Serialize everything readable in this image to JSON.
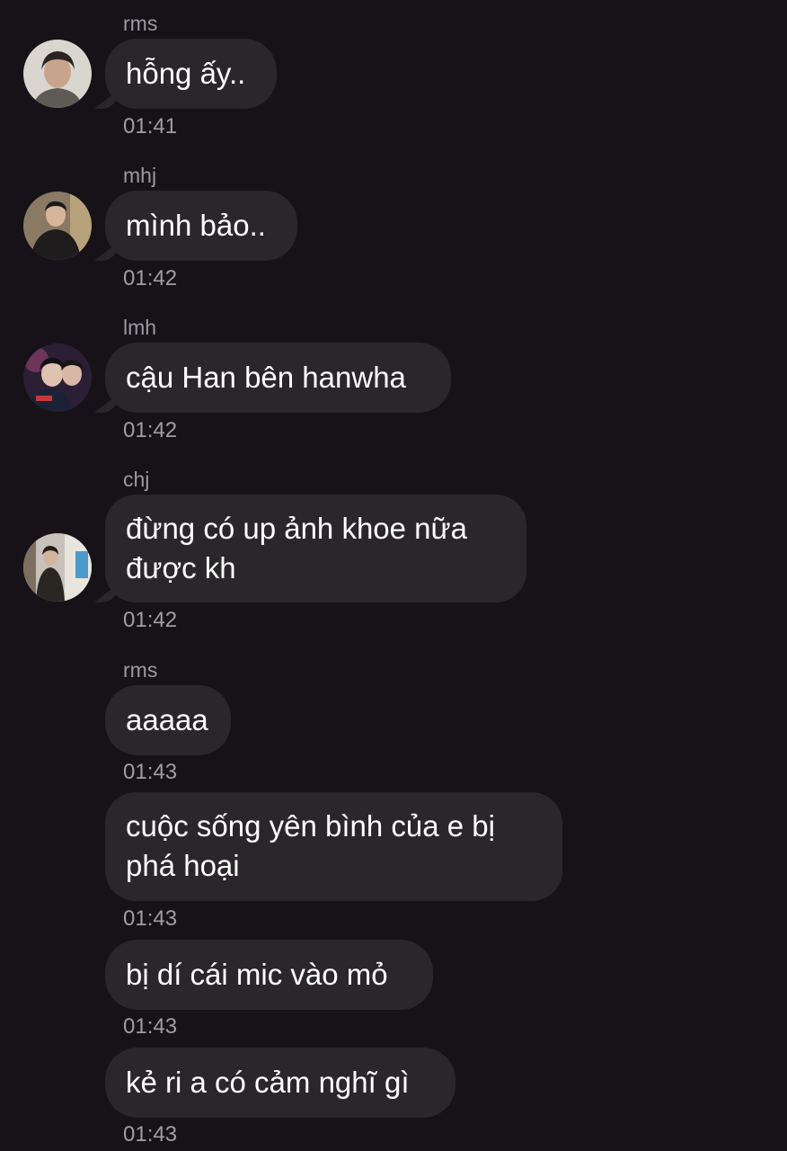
{
  "messages": [
    {
      "sender": "rms",
      "text": "hỗng ấy..",
      "time": "01:41",
      "avatar_icon": "user-avatar-rms"
    },
    {
      "sender": "mhj",
      "text": "mình bảo..",
      "time": "01:42",
      "avatar_icon": "user-avatar-mhj"
    },
    {
      "sender": "lmh",
      "text": "cậu Han bên hanwha",
      "time": "01:42",
      "avatar_icon": "user-avatar-lmh"
    },
    {
      "sender": "chj",
      "text": "đừng có up ảnh khoe nữa được kh",
      "time": "01:42",
      "avatar_icon": "user-avatar-chj"
    },
    {
      "sender": "rms",
      "text": "aaaaa",
      "time": "01:43"
    },
    {
      "text": "cuộc sống yên bình của e bị phá hoại",
      "time": "01:43"
    },
    {
      "text": "bị dí cái mic vào mỏ",
      "time": "01:43"
    },
    {
      "text": "kẻ ri a có cảm nghĩ gì",
      "time": "01:43"
    }
  ],
  "colors": {
    "background": "#161217",
    "bubble": "#2a272c",
    "meta_text": "#a09da3"
  }
}
